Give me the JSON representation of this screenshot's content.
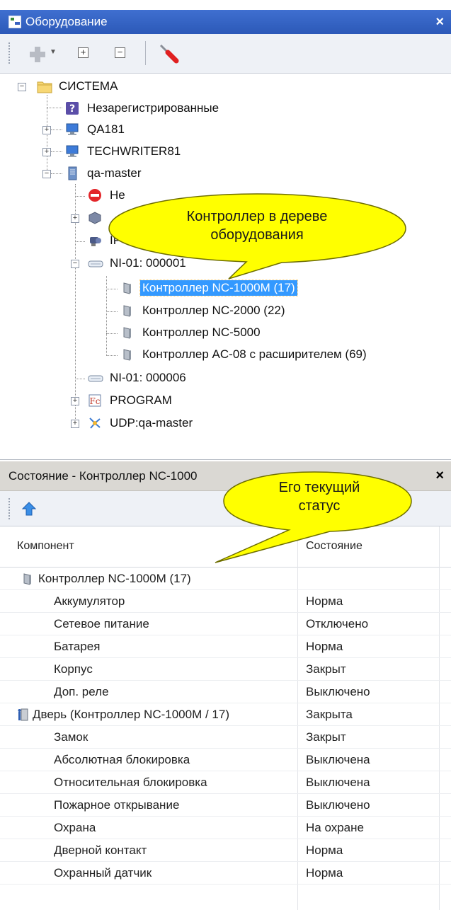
{
  "equipment_panel": {
    "title": "Оборудование",
    "close": "×",
    "toolbar": {
      "expand": "+",
      "collapse": "−",
      "dropdown": "▼"
    },
    "tree": {
      "root": "СИСТЕМА",
      "unregistered": "Незарегистрированные",
      "qa181": "QA181",
      "techwriter": "TECHWRITER81",
      "qa_master": "qa-master",
      "not_reg_partial": "Не",
      "ip_partial": "IP",
      "ni_000001": "NI-01: 000001",
      "ctrl_1000m": "Контроллер NC-1000M (17)",
      "ctrl_2000": "Контроллер NC-2000 (22)",
      "ctrl_5000": "Контроллер NC-5000",
      "ctrl_ac08": "Контроллер AC-08 с расширителем (69)",
      "ni_000006": "NI-01: 000006",
      "program": "PROGRAM",
      "udp": "UDP:qa-master"
    }
  },
  "status_panel": {
    "title": "Состояние - Контроллер NC-1000",
    "close": "×",
    "columns": {
      "component": "Компонент",
      "state": "Состояние"
    },
    "rows": [
      {
        "component": "Контроллер NC-1000M (17)",
        "state": ""
      },
      {
        "component": "Аккумулятор",
        "state": "Норма"
      },
      {
        "component": "Сетевое питание",
        "state": "Отключено"
      },
      {
        "component": "Батарея",
        "state": "Норма"
      },
      {
        "component": "Корпус",
        "state": "Закрыт"
      },
      {
        "component": "Доп. реле",
        "state": "Выключено"
      },
      {
        "component": "Дверь (Контроллер NC-1000M / 17)",
        "state": "Закрыта"
      },
      {
        "component": "Замок",
        "state": "Закрыт"
      },
      {
        "component": "Абсолютная блокировка",
        "state": "Выключена"
      },
      {
        "component": "Относительная блокировка",
        "state": "Выключена"
      },
      {
        "component": "Пожарное открывание",
        "state": "Выключено"
      },
      {
        "component": "Охрана",
        "state": "На охране"
      },
      {
        "component": "Дверной контакт",
        "state": "Норма"
      },
      {
        "component": "Охранный датчик",
        "state": "Норма"
      }
    ]
  },
  "callouts": {
    "tree": {
      "line1": "Контроллер в дереве",
      "line2": "оборудования"
    },
    "status": {
      "line1": "Его текущий",
      "line2": "статус"
    }
  },
  "colors": {
    "title_bar": "#2c59b8",
    "selection": "#3399ff",
    "callout_fill": "#ffff00"
  }
}
